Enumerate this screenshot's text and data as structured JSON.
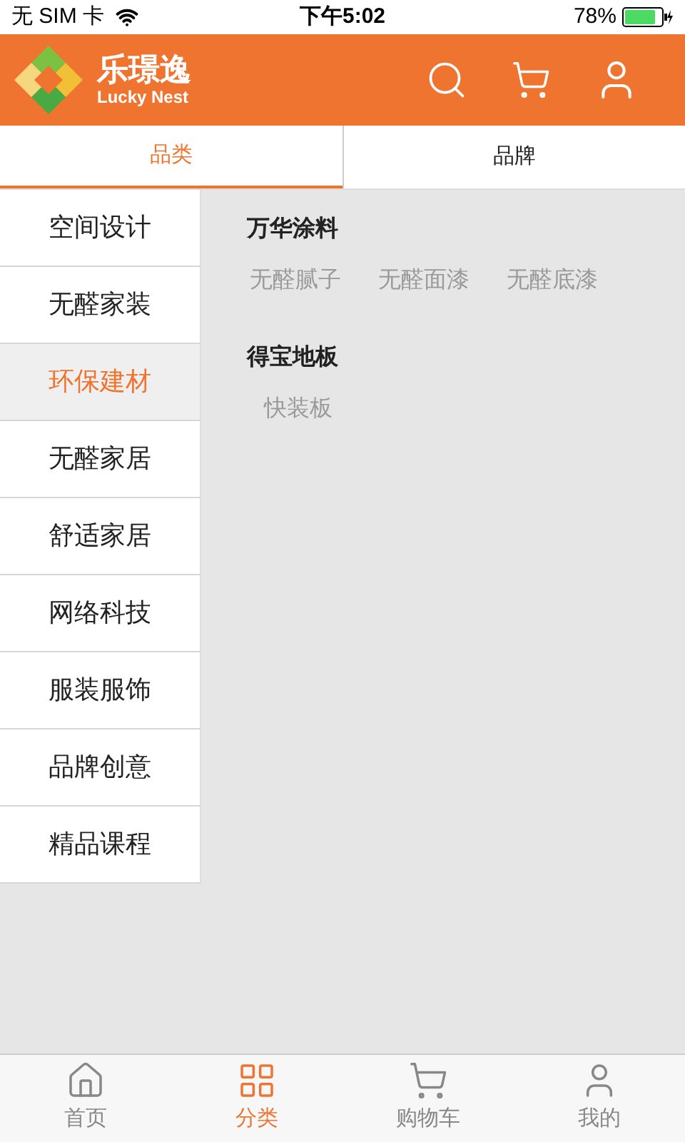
{
  "status_bar": {
    "carrier": "无 SIM 卡",
    "time": "下午5:02",
    "battery": "78%"
  },
  "header": {
    "logo_title": "乐璟逸",
    "logo_subtitle": "Lucky Nest"
  },
  "tabs": [
    {
      "label": "品类",
      "selected": true
    },
    {
      "label": "品牌",
      "selected": false
    }
  ],
  "sidebar": {
    "items": [
      {
        "label": "空间设计",
        "selected": false
      },
      {
        "label": "无醛家装",
        "selected": false
      },
      {
        "label": "环保建材",
        "selected": true
      },
      {
        "label": "无醛家居",
        "selected": false
      },
      {
        "label": "舒适家居",
        "selected": false
      },
      {
        "label": "网络科技",
        "selected": false
      },
      {
        "label": "服装服饰",
        "selected": false
      },
      {
        "label": "品牌创意",
        "selected": false
      },
      {
        "label": "精品课程",
        "selected": false
      }
    ]
  },
  "content": {
    "groups": [
      {
        "title": "万华涂料",
        "items": [
          "无醛腻子",
          "无醛面漆",
          "无醛底漆"
        ]
      },
      {
        "title": "得宝地板",
        "items": [
          "快装板"
        ]
      }
    ]
  },
  "bottom_nav": [
    {
      "label": "首页",
      "kind": "home",
      "selected": false
    },
    {
      "label": "分类",
      "kind": "grid",
      "selected": true
    },
    {
      "label": "购物车",
      "kind": "cart",
      "selected": false
    },
    {
      "label": "我的",
      "kind": "user",
      "selected": false
    }
  ]
}
